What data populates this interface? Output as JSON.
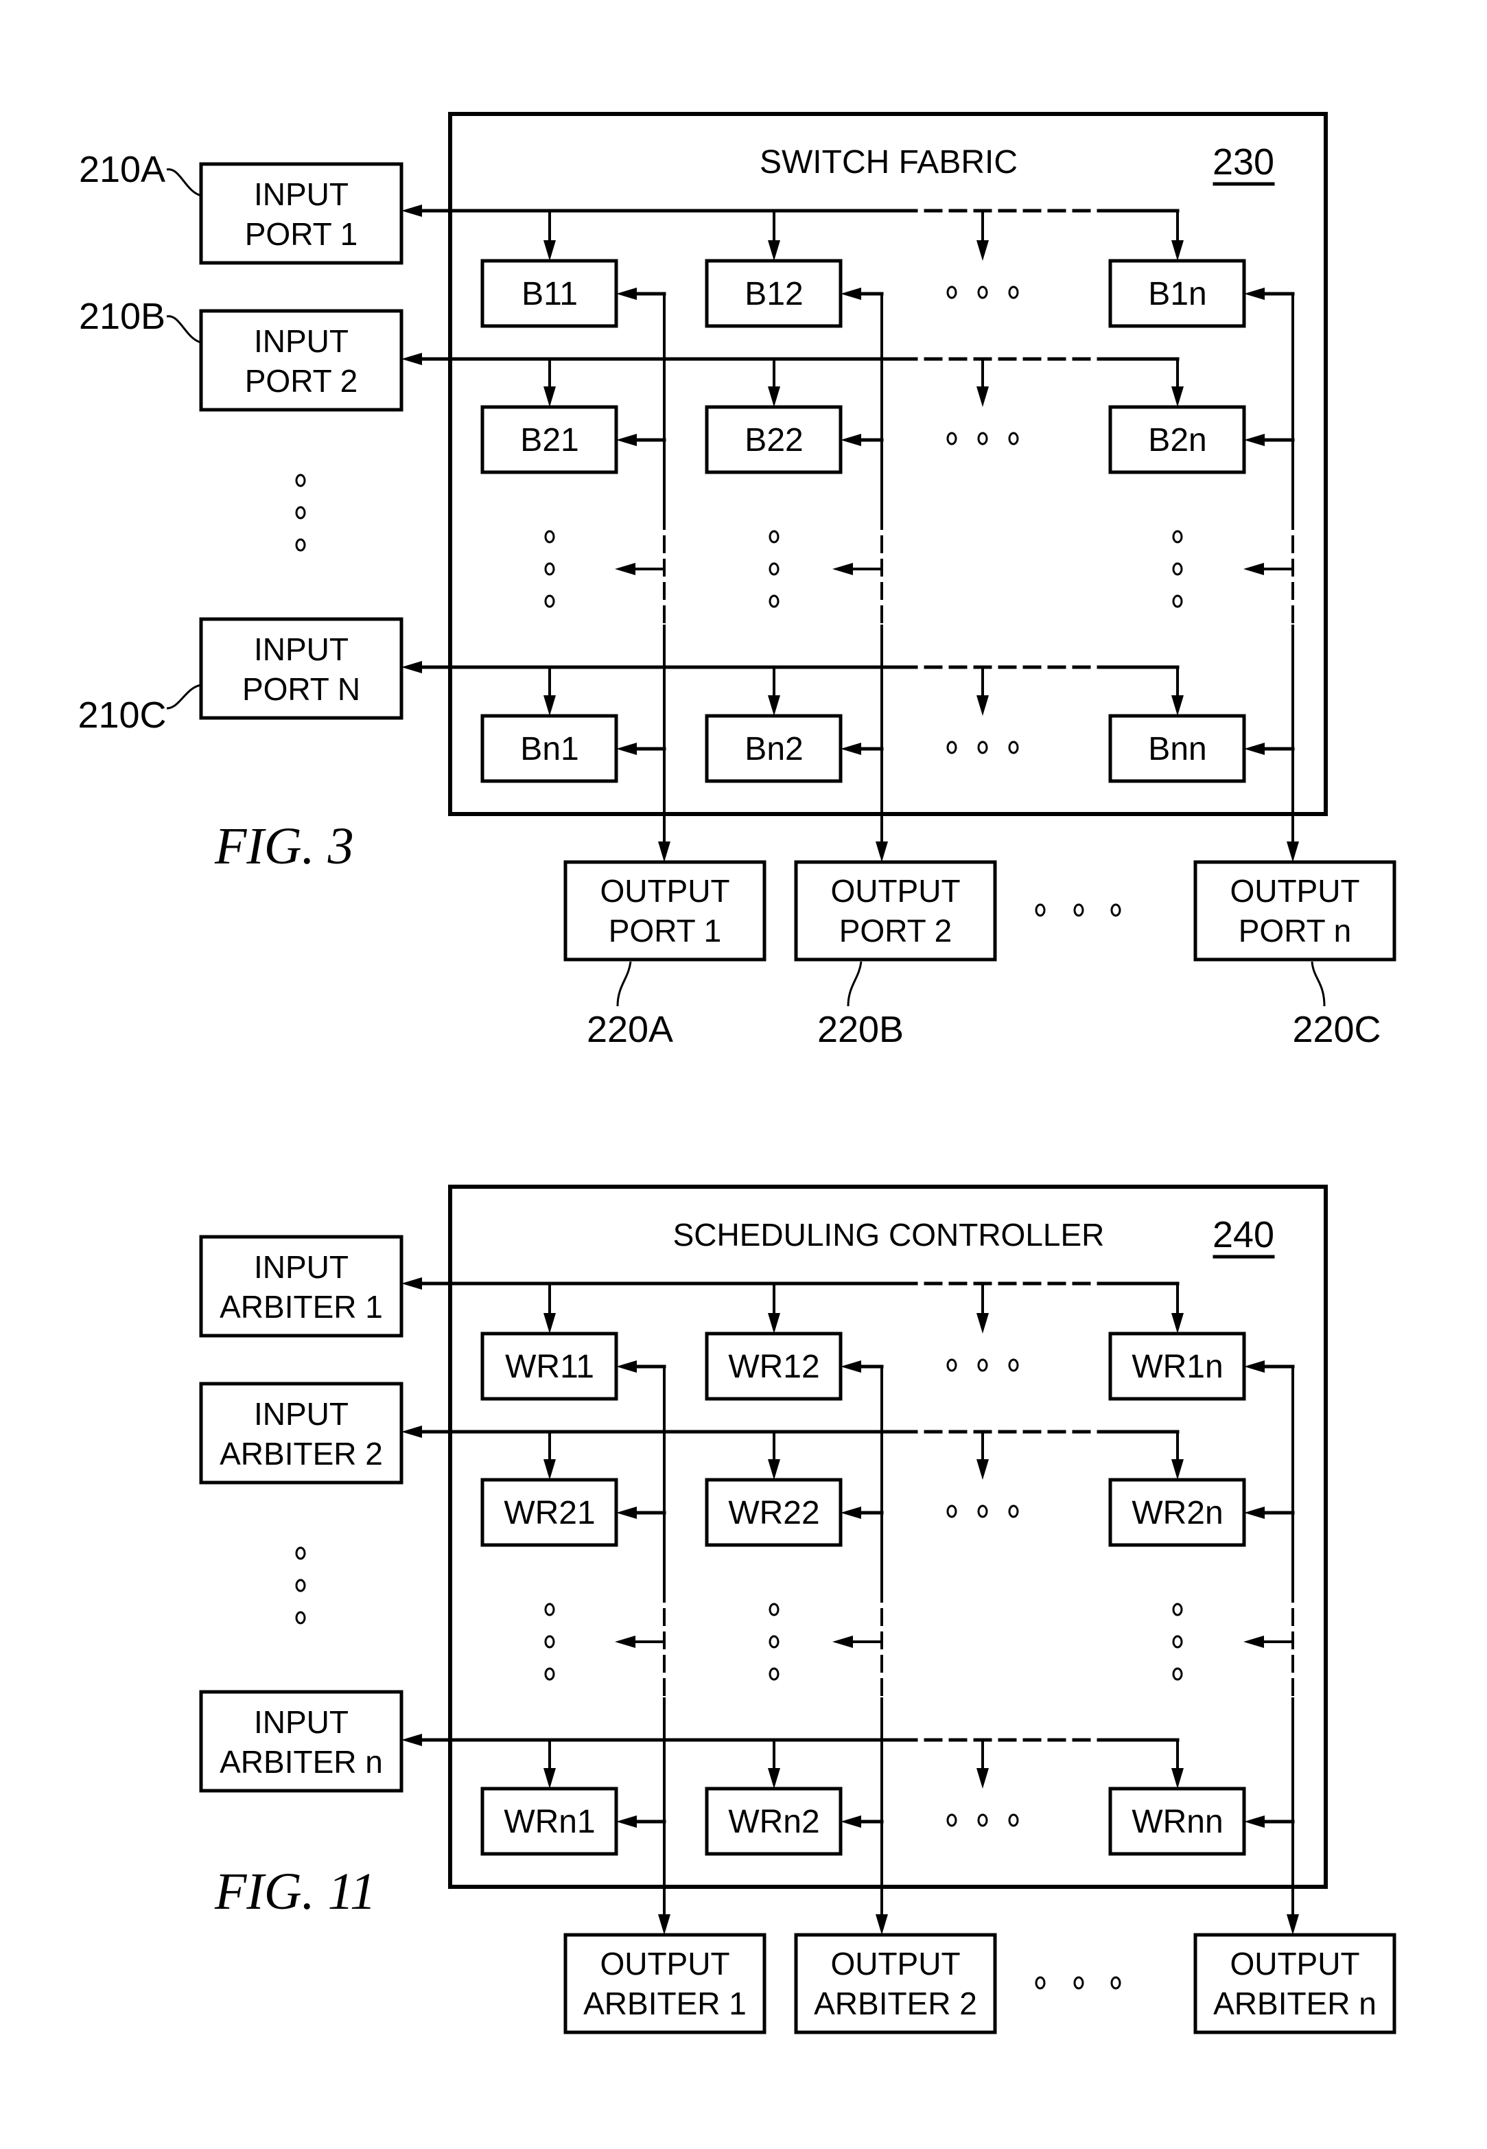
{
  "figures": [
    {
      "id": "fig3",
      "caption": "FIG. 3",
      "container": {
        "title": "SWITCH FABRIC",
        "ref": "230"
      },
      "inputs": [
        {
          "label": [
            "INPUT",
            "PORT 1"
          ],
          "ref": "210A"
        },
        {
          "label": [
            "INPUT",
            "PORT 2"
          ],
          "ref": "210B"
        },
        {
          "label": [
            "INPUT",
            "PORT N"
          ],
          "ref": "210C"
        }
      ],
      "outputs": [
        {
          "label": [
            "OUTPUT",
            "PORT 1"
          ],
          "ref": "220A"
        },
        {
          "label": [
            "OUTPUT",
            "PORT 2"
          ],
          "ref": "220B"
        },
        {
          "label": [
            "OUTPUT",
            "PORT n"
          ],
          "ref": "220C"
        }
      ],
      "cells": [
        [
          "B11",
          "B12",
          "B1n"
        ],
        [
          "B21",
          "B22",
          "B2n"
        ],
        [
          "Bn1",
          "Bn2",
          "Bnn"
        ]
      ]
    },
    {
      "id": "fig11",
      "caption": "FIG. 11",
      "container": {
        "title": "SCHEDULING CONTROLLER",
        "ref": "240"
      },
      "inputs": [
        {
          "label": [
            "INPUT",
            "ARBITER 1"
          ],
          "ref": ""
        },
        {
          "label": [
            "INPUT",
            "ARBITER 2"
          ],
          "ref": ""
        },
        {
          "label": [
            "INPUT",
            "ARBITER n"
          ],
          "ref": ""
        }
      ],
      "outputs": [
        {
          "label": [
            "OUTPUT",
            "ARBITER 1"
          ],
          "ref": ""
        },
        {
          "label": [
            "OUTPUT",
            "ARBITER 2"
          ],
          "ref": ""
        },
        {
          "label": [
            "OUTPUT",
            "ARBITER n"
          ],
          "ref": ""
        }
      ],
      "cells": [
        [
          "WR11",
          "WR12",
          "WR1n"
        ],
        [
          "WR21",
          "WR22",
          "WR2n"
        ],
        [
          "WRn1",
          "WRn2",
          "WRnn"
        ]
      ]
    }
  ],
  "ellipsis_glyph": "ooo"
}
